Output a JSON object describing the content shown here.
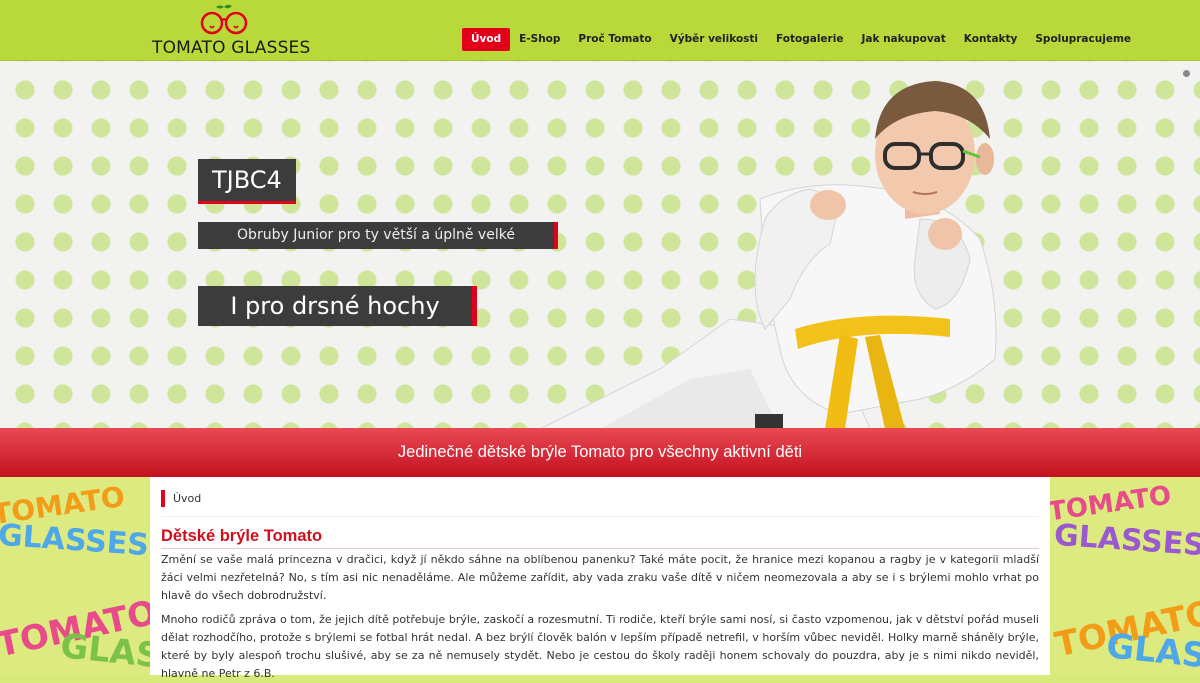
{
  "header": {
    "logo_text": "TOMATO GLASSES",
    "nav": [
      {
        "label": "Úvod",
        "active": true
      },
      {
        "label": "E-Shop",
        "active": false
      },
      {
        "label": "Proč Tomato",
        "active": false
      },
      {
        "label": "Výběr velikosti",
        "active": false
      },
      {
        "label": "Fotogalerie",
        "active": false
      },
      {
        "label": "Jak nakupovat",
        "active": false
      },
      {
        "label": "Kontakty",
        "active": false
      },
      {
        "label": "Spolupracujeme",
        "active": false
      }
    ]
  },
  "hero": {
    "caption_code": "TJBC4",
    "caption_sub": "Obruby Junior pro ty větší a úplně velké",
    "caption_tag": "I pro drsné hochy"
  },
  "banner": {
    "text": "Jedinečné dětské brýle Tomato pro všechny aktivní děti"
  },
  "side_decor": {
    "word1": "TOMATO",
    "word2": "GLASSES"
  },
  "content": {
    "breadcrumb": "Úvod",
    "title": "Dětské brýle Tomato",
    "paragraphs": [
      "Změní se vaše malá princezna v dračici, když jí někdo sáhne na oblíbenou panenku? Také máte pocit, že hranice mezi kopanou a ragby je v kategorii mladší žáci velmi nezřetelná? No, s tím asi nic nenaděláme. Ale můžeme zařídit, aby vada zraku vaše dítě v ničem neomezovala a aby se i s brýlemi mohlo vrhat po hlavě do všech dobrodružství.",
      "Mnoho rodičů zpráva o tom, že jejich dítě potřebuje brýle, zaskočí a rozesmutní. Ti rodiče, kteří brýle sami nosí, si často vzpomenou, jak v dětství pořád museli dělat rozhodčího, protože s brýlemi se fotbal hrát nedal. A bez brýlí člověk balón v lepším případě netrefil, v horším vůbec neviděl. Holky marně sháněly brýle, které by byly alespoň trochu slušivé, aby se za ně nemusely stydět. Nebo je cestou do školy raději honem schovaly do pouzdra, aby je s nimi nikdo neviděl, hlavně ne Petr z 6.B."
    ]
  },
  "colors": {
    "header_green": "#b9d93a",
    "accent_red": "#e2001a",
    "caption_dark": "#3c3c3c"
  }
}
